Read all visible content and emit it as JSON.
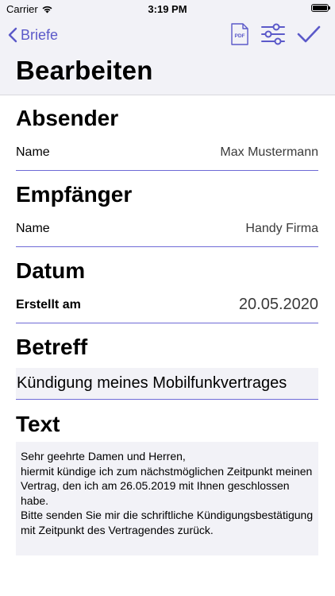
{
  "status_bar": {
    "carrier": "Carrier",
    "time": "3:19 PM"
  },
  "nav": {
    "back_label": "Briefe",
    "title": "Bearbeiten",
    "pdf_icon_text": "PDF"
  },
  "colors": {
    "accent": "#5b59c9",
    "header_bg": "#f2f2f7",
    "separator": "#6e6ad6"
  },
  "sections": {
    "sender": {
      "title": "Absender",
      "name_label": "Name",
      "name_value": "Max Mustermann"
    },
    "recipient": {
      "title": "Empfänger",
      "name_label": "Name",
      "name_value": "Handy Firma"
    },
    "date": {
      "title": "Datum",
      "created_label": "Erstellt am",
      "created_value": "20.05.2020"
    },
    "subject": {
      "title": "Betreff",
      "value": "Kündigung meines Mobilfunkvertrages"
    },
    "text": {
      "title": "Text",
      "value": "Sehr geehrte Damen und Herren,\nhiermit kündige ich zum nächstmöglichen Zeitpunkt meinen Vertrag, den ich am 26.05.2019 mit Ihnen geschlossen habe.\nBitte senden Sie mir die schriftliche Kündigungsbestätigung mit Zeitpunkt des Vertragendes zurück."
    }
  }
}
